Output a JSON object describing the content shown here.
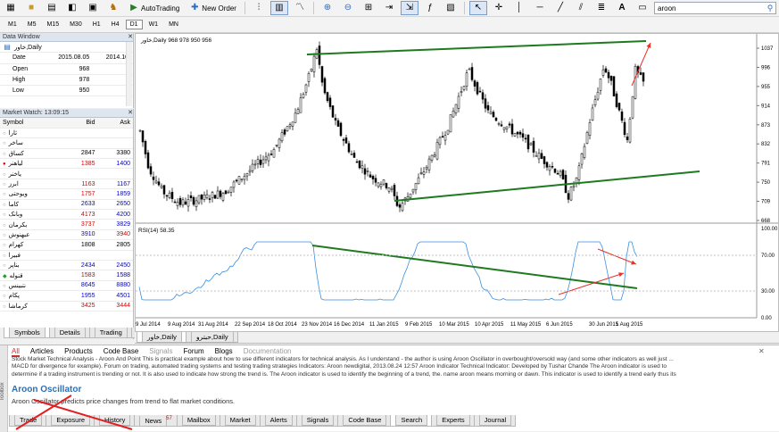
{
  "toolbar": {
    "autotrading_label": "AutoTrading",
    "new_order_label": "New Order",
    "search_value": "aroon"
  },
  "timeframes": [
    "M1",
    "M5",
    "M15",
    "M30",
    "H1",
    "H4",
    "D1",
    "W1",
    "MN"
  ],
  "active_timeframe": "D1",
  "data_window": {
    "title": "Data Window",
    "symbol": "خاور,Daily",
    "rows": [
      {
        "label": "Date",
        "v1": "2015.08.05",
        "v2": "2014.10."
      },
      {
        "label": "Open",
        "v1": "968",
        "v2": "8"
      },
      {
        "label": "High",
        "v1": "978",
        "v2": "8"
      },
      {
        "label": "Low",
        "v1": "950",
        "v2": "7"
      }
    ]
  },
  "market_watch": {
    "title": "Market Watch: 13:09:15",
    "columns": [
      "Symbol",
      "Bid",
      "Ask"
    ],
    "rows": [
      {
        "symbol": "ثارا",
        "bid": "",
        "ask": "",
        "bid_color": "",
        "ask_color": ""
      },
      {
        "symbol": "ساخر",
        "bid": "",
        "ask": "",
        "bid_color": "",
        "ask_color": ""
      },
      {
        "symbol": "کساق",
        "bid": "2847",
        "ask": "3380",
        "bid_color": "black",
        "ask_color": "black"
      },
      {
        "symbol": "لیاهنر",
        "bid": "1385",
        "ask": "1400",
        "bid_color": "red",
        "ask_color": "blue"
      },
      {
        "symbol": "یاخنر",
        "bid": "",
        "ask": "",
        "bid_color": "",
        "ask_color": ""
      },
      {
        "symbol": "ابرز",
        "bid": "1163",
        "ask": "1167",
        "bid_color": "red",
        "ask_color": "blue"
      },
      {
        "symbol": "ویوحتی",
        "bid": "1757",
        "ask": "1859",
        "bid_color": "red",
        "ask_color": "blue"
      },
      {
        "symbol": "کاما",
        "bid": "2633",
        "ask": "2650",
        "bid_color": "blue",
        "ask_color": "blue"
      },
      {
        "symbol": "وبانک",
        "bid": "4173",
        "ask": "4200",
        "bid_color": "red",
        "ask_color": "blue"
      },
      {
        "symbol": "بکرمان",
        "bid": "3737",
        "ask": "3829",
        "bid_color": "red",
        "ask_color": "blue"
      },
      {
        "symbol": "عبهنوش",
        "bid": "3910",
        "ask": "3940",
        "bid_color": "blue",
        "ask_color": "red"
      },
      {
        "symbol": "کهرام",
        "bid": "1808",
        "ask": "2805",
        "bid_color": "black",
        "ask_color": "black"
      },
      {
        "symbol": "فبیرا",
        "bid": "",
        "ask": "",
        "bid_color": "",
        "ask_color": ""
      },
      {
        "symbol": "بناپر",
        "bid": "2434",
        "ask": "2450",
        "bid_color": "blue",
        "ask_color": "blue"
      },
      {
        "symbol": "قنوله",
        "bid": "1583",
        "ask": "1588",
        "bid_color": "red",
        "ask_color": "blue"
      },
      {
        "symbol": "نتبینس",
        "bid": "8645",
        "ask": "8880",
        "bid_color": "blue",
        "ask_color": "blue"
      },
      {
        "symbol": "پکام",
        "bid": "1955",
        "ask": "4501",
        "bid_color": "blue",
        "ask_color": "blue"
      },
      {
        "symbol": "کرماشا",
        "bid": "3425",
        "ask": "3444",
        "bid_color": "red",
        "ask_color": "red"
      }
    ],
    "tabs": [
      "Symbols",
      "Details",
      "Trading",
      "Ticks"
    ],
    "active_tab": "Symbols"
  },
  "chart": {
    "main_label": "خاور,Daily  968 978 950 956",
    "rsi_label": "RSI(14) 58.35",
    "price_labels": [
      "1037",
      "996",
      "955",
      "914",
      "873",
      "832",
      "791",
      "750",
      "709",
      "668"
    ],
    "rsi_labels": [
      "100.00",
      "70.00",
      "30.00",
      "0.00"
    ],
    "date_labels": [
      "9 Jul 2014",
      "9 Aug 2014",
      "31 Aug 2014",
      "22 Sep 2014",
      "18 Oct 2014",
      "23 Nov 2014",
      "16 Dec 2014",
      "11 Jan 2015",
      "9 Feb 2015",
      "10 Mar 2015",
      "10 Apr 2015",
      "11 May 2015",
      "6 Jun 2015",
      "30 Jun 2015",
      "1 Aug 2015"
    ],
    "tabs": [
      "خاور,Daily",
      "حبترو,Daily"
    ],
    "active_tab": "خاور,Daily",
    "colors": {
      "candle": "#000000",
      "trend": "#1e7a1e",
      "arrow": "#e8322a",
      "rsi": "#3a8fe0"
    }
  },
  "browser": {
    "tabs": [
      "All",
      "Articles",
      "Products",
      "Code Base",
      "Signals",
      "Forum",
      "Blogs",
      "Documentation"
    ],
    "active_tab": "All",
    "disabled_tabs": [
      "Signals",
      "Documentation"
    ],
    "text_line1": "Stock Market Technical Analysis - Aroon And Point This is practical example about how to use different indicators for technical analysis. As I understand - the author is using Aroon Oscillator in overbought/oversold way (and some other indicators as well just ...",
    "text_line2": "MACD for divergence for example). Forum on trading, automated trading systems and testing trading strategies Indicators: Aroon newdigital, 2013.08.24 12:57 Aroon Indicator Technical Indicator: Developed by Tushar Chande The Aroon indicator is used to",
    "text_line3": "determine if a trading instrument is trending or not. It is also used to indicate how strong the trend is. The Aroon indicator is used to identify the beginning of a trend, the. name aroon means morning or dawn. This indicator is used to identify a trend early thus its",
    "heading": "Aroon Oscillator",
    "desc": "Aroon Oscillator predicts price changes from trend to flat market conditions.",
    "side_label": "Toolbox"
  },
  "terminal_tabs": [
    {
      "label": "Trade",
      "badge": ""
    },
    {
      "label": "Exposure",
      "badge": ""
    },
    {
      "label": "History",
      "badge": ""
    },
    {
      "label": "News",
      "badge": "57"
    },
    {
      "label": "Mailbox",
      "badge": ""
    },
    {
      "label": "Market",
      "badge": ""
    },
    {
      "label": "Alerts",
      "badge": ""
    },
    {
      "label": "Signals",
      "badge": ""
    },
    {
      "label": "Code Base",
      "badge": ""
    },
    {
      "label": "Search",
      "badge": ""
    },
    {
      "label": "Experts",
      "badge": ""
    },
    {
      "label": "Journal",
      "badge": ""
    }
  ],
  "active_terminal_tab": "Search"
}
